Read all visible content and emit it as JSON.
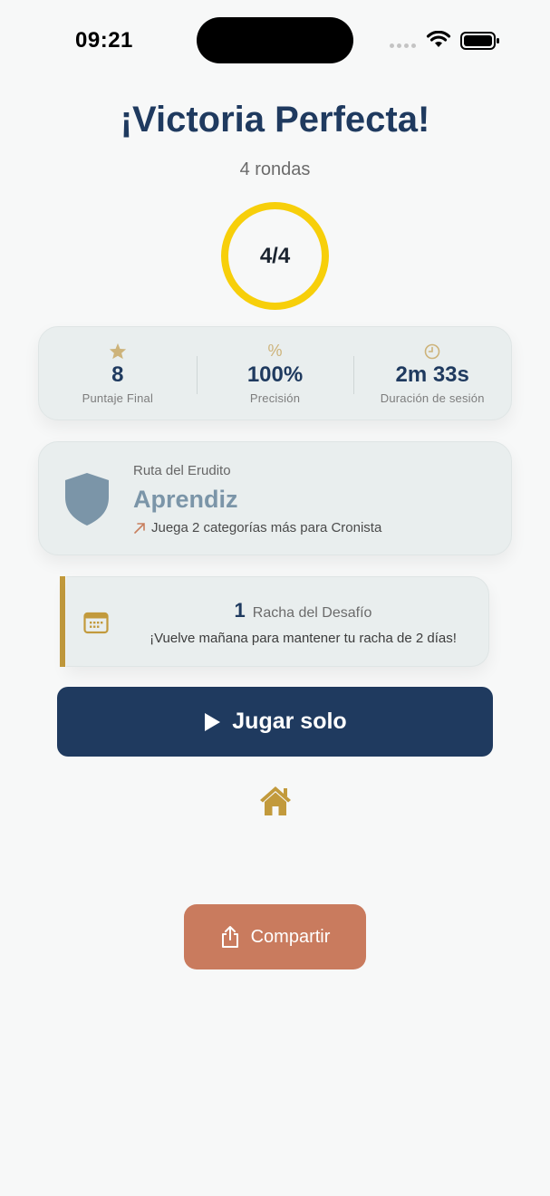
{
  "status_bar": {
    "time": "09:21"
  },
  "result": {
    "title": "¡Victoria Perfecta!",
    "rounds": "4 rondas",
    "score": "4/4"
  },
  "stats": [
    {
      "icon": "star-icon",
      "value": "8",
      "label": "Puntaje Final"
    },
    {
      "icon": "percent-icon",
      "glyph": "%",
      "value": "100%",
      "label": "Precisión"
    },
    {
      "icon": "clock-icon",
      "value": "2m 33s",
      "label": "Duración de sesión"
    }
  ],
  "path": {
    "kicker": "Ruta del Erudito",
    "level": "Aprendiz",
    "hint": "Juega 2 categorías más para Cronista"
  },
  "streak": {
    "count": "1",
    "label": "Racha del Desafío",
    "message": "¡Vuelve mañana para mantener tu racha de 2 días!"
  },
  "actions": {
    "play_label": "Jugar solo",
    "share_label": "Compartir"
  },
  "colors": {
    "primary": "#1f3a5f",
    "ring": "#f7cf0a",
    "accent_gold": "#c29a3c",
    "share": "#c97b5e",
    "shield": "#7b95a8"
  }
}
